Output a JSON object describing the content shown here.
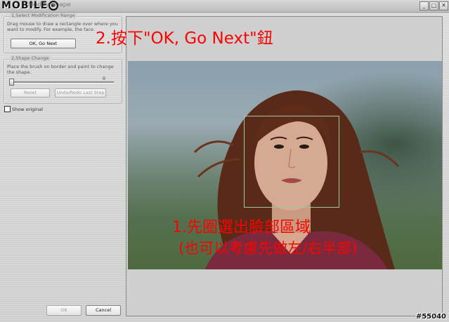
{
  "window": {
    "logo": "MOBILE",
    "title": "Modify Shape"
  },
  "titlebar_buttons": [
    "_",
    "□",
    "✕"
  ],
  "group1": {
    "title": "1,Select Modification Range",
    "hint": "Drag mouse to draw a rectangle over where you want to modify. For example, the face.",
    "button": "OK, Go Next"
  },
  "group2": {
    "title": "2,Shape Change",
    "hint": "Place the brush on border and paint to change the shape.",
    "slider_value": "0",
    "reset_button": "Reset",
    "undo_button": "Undo/Redo Last Step"
  },
  "show_original": "Show original",
  "footer": {
    "ok_button": "OK",
    "cancel_button": "Cancel"
  },
  "annotations": {
    "step2": "2.按下\"OK, Go Next\"鈕",
    "step1_line1": "1.先圈選出臉部區域",
    "step1_line2": "(也可以考慮先做左/右半部)"
  },
  "watermark": "#55040",
  "colors": {
    "annotation": "#ff0000",
    "selection": "#9cc7a6"
  }
}
